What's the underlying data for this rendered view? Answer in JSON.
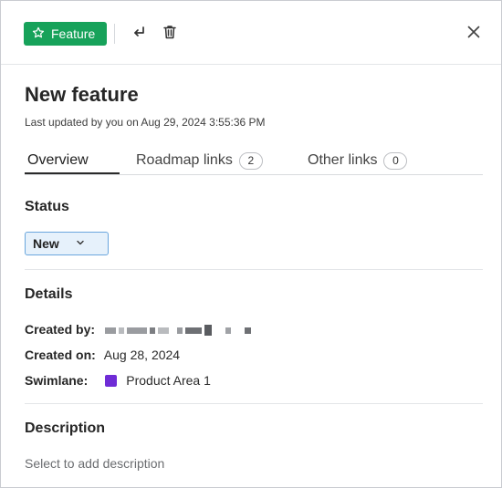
{
  "header": {
    "type_badge_label": "Feature",
    "type_badge_color": "#17a25a",
    "icons": [
      "star-icon",
      "return-icon",
      "trash-icon",
      "close-icon"
    ]
  },
  "title": "New feature",
  "last_updated": "Last updated by you on Aug 29, 2024 3:55:36 PM",
  "tabs": [
    {
      "label": "Overview",
      "count": null,
      "active": true
    },
    {
      "label": "Roadmap links",
      "count": "2",
      "active": false
    },
    {
      "label": "Other links",
      "count": "0",
      "active": false
    }
  ],
  "status": {
    "heading": "Status",
    "value": "New"
  },
  "details": {
    "heading": "Details",
    "created_by_label": "Created by:",
    "created_on_label": "Created on:",
    "created_on_value": "Aug 28, 2024",
    "swimlane_label": "Swimlane:",
    "swimlane_value": "Product Area 1",
    "swimlane_color": "#6f2cd6"
  },
  "description": {
    "heading": "Description",
    "placeholder": "Select to add description"
  }
}
